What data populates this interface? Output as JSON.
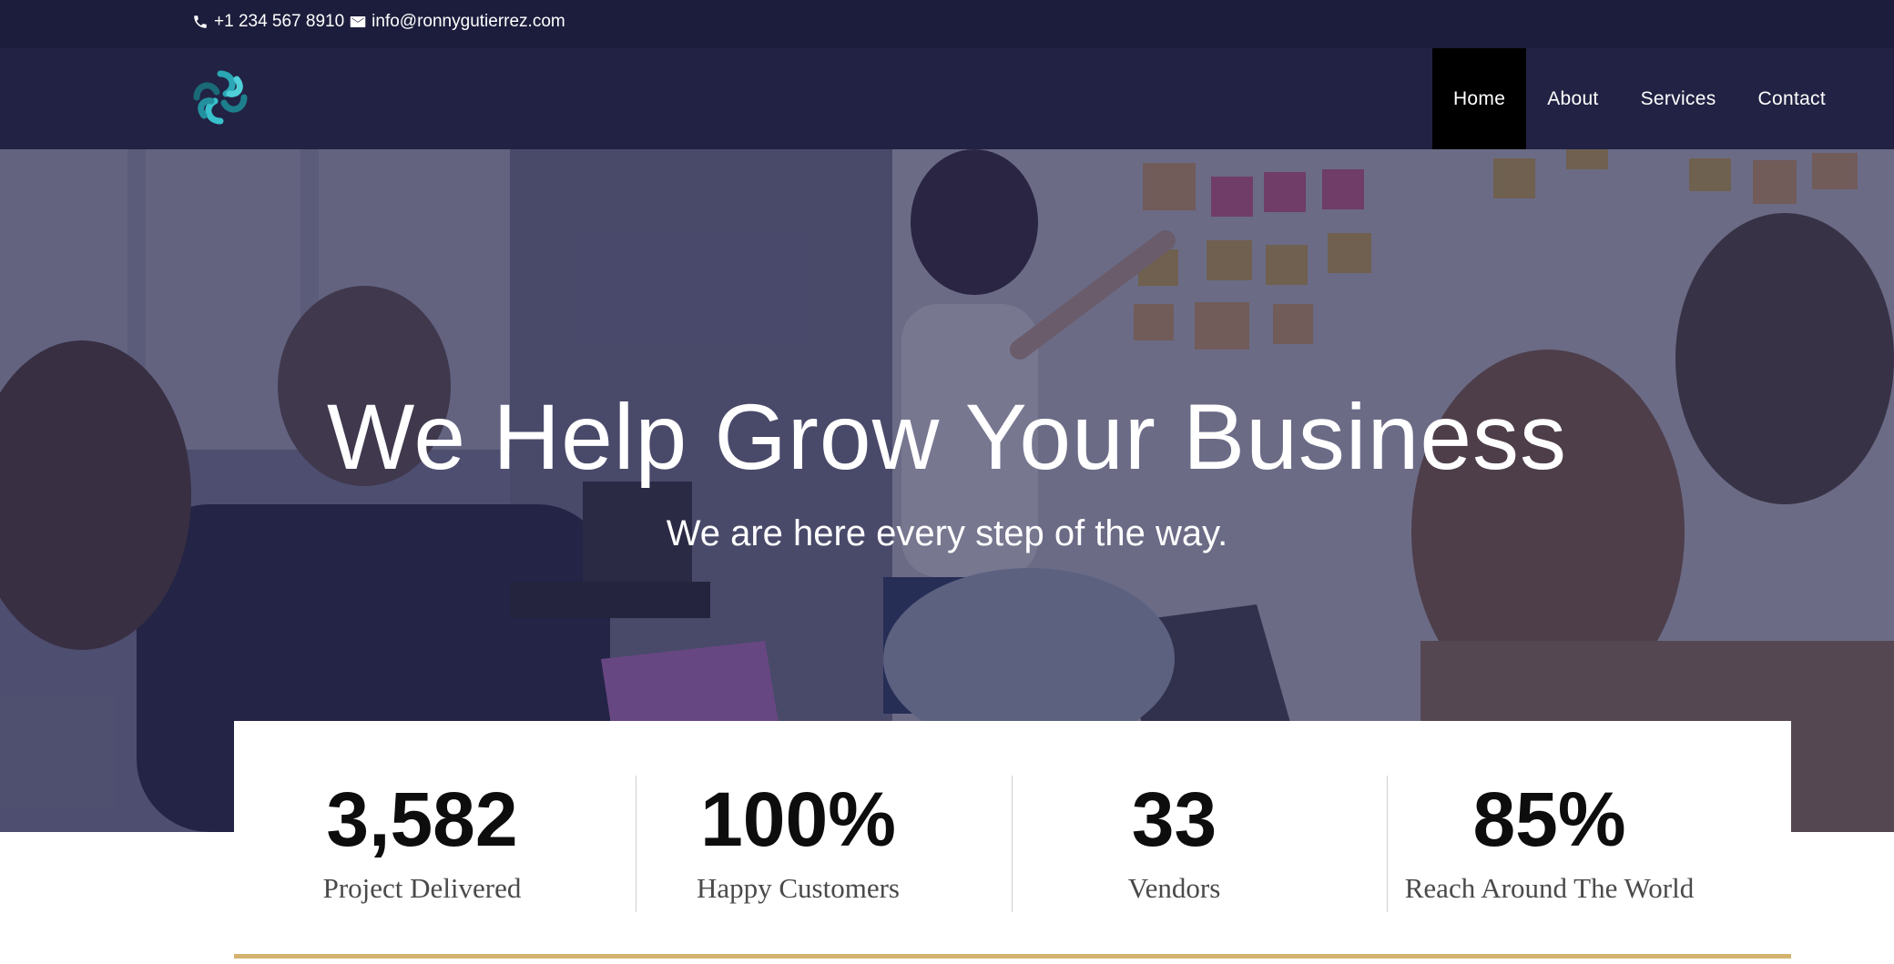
{
  "topbar": {
    "phone": "+1 234 567 8910",
    "email": "info@ronnygutierrez.com"
  },
  "nav": {
    "items": [
      {
        "label": "Home",
        "active": true
      },
      {
        "label": "About",
        "active": false
      },
      {
        "label": "Services",
        "active": false
      },
      {
        "label": "Contact",
        "active": false
      }
    ]
  },
  "hero": {
    "title": "We Help Grow Your Business",
    "subtitle": "We are here every step of the way."
  },
  "stats": [
    {
      "value": "3,582",
      "label": "Project Delivered"
    },
    {
      "value": "100%",
      "label": "Happy Customers"
    },
    {
      "value": "33",
      "label": "Vendors"
    },
    {
      "value": "85%",
      "label": "Reach Around The World"
    }
  ],
  "colors": {
    "topbar": "#1c1d3c",
    "navbar": "#222244",
    "active_nav": "#000000",
    "accent_gold": "#d4b36e",
    "logo_teal": "#2aa6b4"
  },
  "icons": {
    "phone": "phone-icon",
    "email": "envelope-icon",
    "logo": "flower-knot-logo"
  }
}
